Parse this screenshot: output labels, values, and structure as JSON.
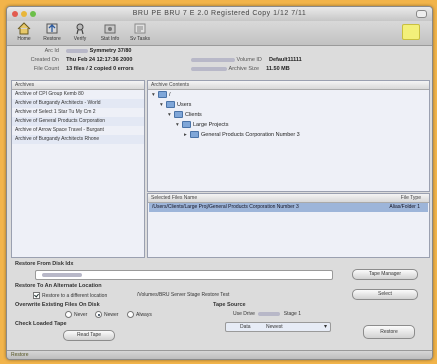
{
  "window": {
    "title": "BRU PE  BRU 7 E 2.0 Registered Copy 1/12 7/11"
  },
  "toolbar": {
    "items": [
      {
        "label": "Home",
        "icon": "home-icon"
      },
      {
        "label": "Restore",
        "icon": "restore-icon"
      },
      {
        "label": "Verify",
        "icon": "verify-icon"
      },
      {
        "label": "Stat Info",
        "icon": "stat-info-icon"
      },
      {
        "label": "Sv Tasks",
        "icon": "tasks-icon"
      }
    ]
  },
  "info": {
    "archive_id_label": "Arc Id",
    "archive_id_value": "Symmetry 37/80",
    "created_label": "Created On",
    "created_value": "Thu Feb 24 12:17:36 2000",
    "file_count_label": "File Count",
    "file_count_value": "13 files / 2 copied 0 errors",
    "volume_label": "Volume ID",
    "volume_value": "Default11111",
    "size_label": "Archive Size",
    "size_value": "11.50 MB"
  },
  "archives_panel": {
    "header": "Archives",
    "rows": [
      "Archive of CPI Group    Kemb 80",
      "Archive of Burgandy Architects - World",
      "Archive of Select 1 Star   Tu My Cm 2",
      "Archive of General Products Corporation",
      "Archive of Arrow Space Travel - Burgant",
      "Archive of Burgandy Architects  Rhone"
    ]
  },
  "contents_panel": {
    "header": "Archive Contents",
    "tree": [
      {
        "label": "/",
        "level": 0
      },
      {
        "label": "Users",
        "level": 1
      },
      {
        "label": "Clients",
        "level": 2
      },
      {
        "label": "Large Projects",
        "level": 3
      },
      {
        "label": "General Products Corporation   Number 3",
        "level": 4
      }
    ]
  },
  "selected_panel": {
    "header": "Selected Files Name",
    "header_right": "File Type",
    "row_left": "/Users/Clients/Large Proj/General Products Corporation  Number 3",
    "row_right": "Alias/Folder 1"
  },
  "restore": {
    "from_disk_label": "Restore From Disk Idx",
    "alternate_label": "Restore To An Alternate Location",
    "different_location_label": "Restore to a different location",
    "different_location_value": "/Volumes/BRU Server Stage Restore Test",
    "overwrite_label": "Overwrite Existing Files On Disk",
    "overwrite_options": [
      "Never",
      "Newer",
      "Always"
    ],
    "overwrite_selected": 1,
    "tape_source_label": "Tape Source",
    "use_drive_label": "Use Drive",
    "use_drive_value": "Stage 1",
    "data_label": "Data",
    "data_value": "Newest",
    "check_label": "Check Loaded Tape",
    "read_button": "Read Tape",
    "tape_manager_button": "Tape Manager",
    "select_button": "Select",
    "restore_button": "Restore"
  },
  "status": {
    "text": "Restore"
  },
  "colors": {
    "background": "#f2b44a",
    "selection": "#9db5d9"
  }
}
